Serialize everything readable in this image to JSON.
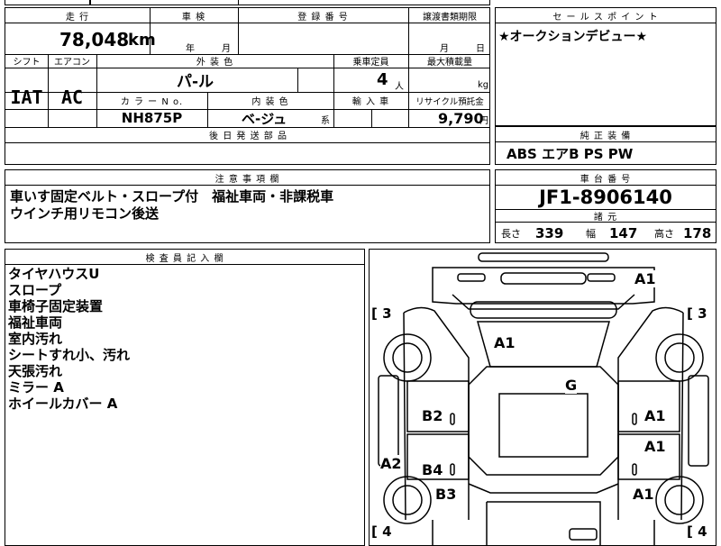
{
  "main": {
    "h_mileage": "走 行",
    "h_inspection": "車 検",
    "h_registration": "登 録 番 号",
    "h_transfer": "譲渡書類期限",
    "mileage_value": "78,048",
    "mileage_unit": "km",
    "inspect_year": "年",
    "inspect_month": "月",
    "transfer_month": "月",
    "transfer_day": "日",
    "h_shift": "シフト",
    "h_aircon": "エアコン",
    "h_exterior": "外 装 色",
    "h_capacity": "乗車定員",
    "h_maxload": "最大積載量",
    "shift_value": "IAT",
    "aircon_value": "AC",
    "exterior_value": "パ-ル",
    "capacity_value": "4",
    "capacity_unit": "人",
    "load_unit": "kg",
    "h_colorno": "カ ラ ー N o.",
    "h_interior": "内 装 色",
    "h_import": "輸 入 車",
    "h_recycle": "リサイクル預託金",
    "colorno_value": "NH875P",
    "interior_value": "ベ-ジュ",
    "interior_suffix": "系",
    "recycle_value": "9,790",
    "recycle_unit": "円",
    "h_parts": "後 日 発 送 部 品"
  },
  "sales_point": {
    "header": "セ ー ル ス ポ イ ン ト",
    "text": "★オークションデビュー★"
  },
  "equipment": {
    "header": "純 正 装 備",
    "text": "ABS エアB PS PW"
  },
  "caution": {
    "header": "注 意 事 項 欄",
    "line1": "車いす固定ベルト・スロープ付　福祉車両・非課税車",
    "line2": "ウインチ用リモコン後送"
  },
  "chassis": {
    "header": "車 台 番 号",
    "value": "JF1-8906140",
    "spec_header": "諸 元",
    "length_label": "長さ",
    "length_value": "339",
    "width_label": "幅",
    "width_value": "147",
    "height_label": "高さ",
    "height_value": "178"
  },
  "inspector": {
    "header": "検 査 員 記 入 欄",
    "items": [
      "タイヤハウスU",
      "スロープ",
      "車椅子固定装置",
      "福祉車両",
      "室内汚れ",
      "シートすれ小、汚れ",
      "天張汚れ",
      "ミラー A",
      "ホイールカバー A"
    ]
  },
  "diagram": {
    "marks": {
      "top_right": "A1",
      "hood": "A1",
      "roof": "G",
      "left_front_door": "B2",
      "left_rear_door": "B4",
      "left_rear_fender": "B3",
      "left_side": "A2",
      "right_front_door": "A1",
      "right_rear_door": "A1",
      "right_rear_fender": "A1"
    },
    "tires": {
      "front_left": "[ 3",
      "front_right": "[ 3",
      "rear_left": "[ 4",
      "rear_right": "[ 4"
    }
  }
}
